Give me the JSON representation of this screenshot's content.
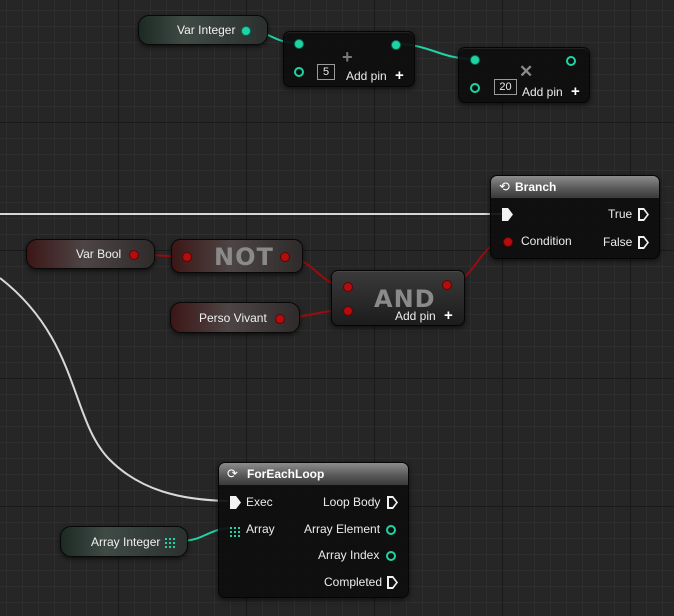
{
  "nodes": {
    "var_integer": {
      "label": "Var Integer"
    },
    "add": {
      "value": "5",
      "add_pin": "Add pin",
      "operator_icon": "plus"
    },
    "multiply": {
      "value": "20",
      "add_pin": "Add pin",
      "operator_icon": "multiply"
    },
    "branch": {
      "title": "Branch",
      "condition": "Condition",
      "true_label": "True",
      "false_label": "False"
    },
    "var_bool": {
      "label": "Var Bool"
    },
    "not": {
      "label": "NOT"
    },
    "and": {
      "label": "AND",
      "add_pin": "Add pin"
    },
    "perso_vivant": {
      "label": "Perso Vivant"
    },
    "foreach": {
      "title": "ForEachLoop",
      "exec": "Exec",
      "array": "Array",
      "loop_body": "Loop Body",
      "array_element": "Array Element",
      "array_index": "Array Index",
      "completed": "Completed"
    },
    "array_integer": {
      "label": "Array Integer"
    }
  },
  "colors": {
    "integer_pin": "#1ed4a4",
    "bool_pin": "#b30d0d",
    "exec_pin": "#f2f2f2",
    "background": "#262626"
  }
}
